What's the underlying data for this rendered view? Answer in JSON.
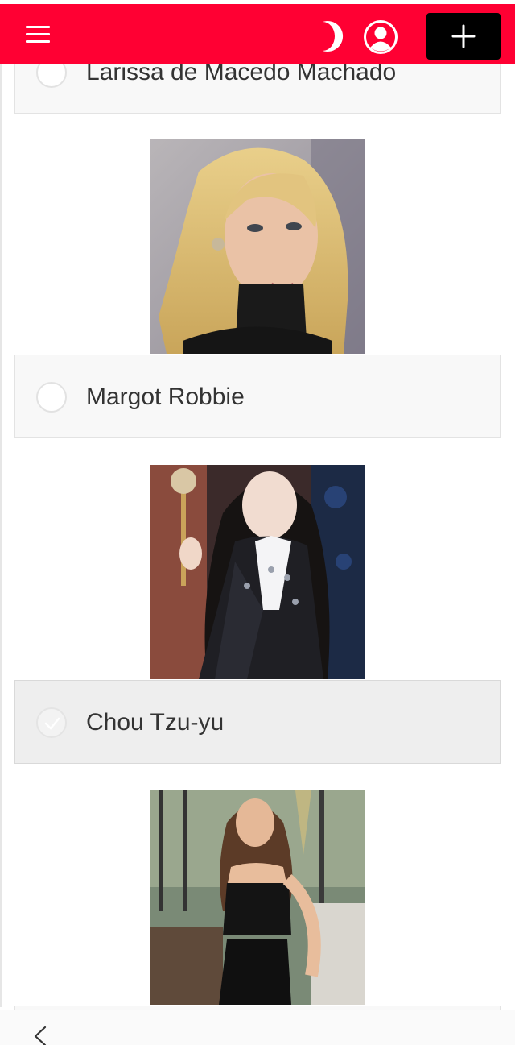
{
  "header": {
    "menu_icon": "hamburger-menu-icon",
    "theme_icon": "moon-icon",
    "account_icon": "user-circle-icon",
    "add_icon": "plus-icon",
    "brand_color": "#ff0033"
  },
  "options": [
    {
      "label": "Larissa de Macedo Machado",
      "selected": false
    },
    {
      "label": "Margot Robbie",
      "selected": false
    },
    {
      "label": "Chou Tzu-yu",
      "selected": true
    },
    {
      "label": "",
      "selected": false
    }
  ],
  "photos": [
    {
      "alt": "Margot Robbie"
    },
    {
      "alt": "Chou Tzu-yu"
    },
    {
      "alt": ""
    }
  ],
  "footer": {
    "back_icon": "chevron-left-icon"
  }
}
